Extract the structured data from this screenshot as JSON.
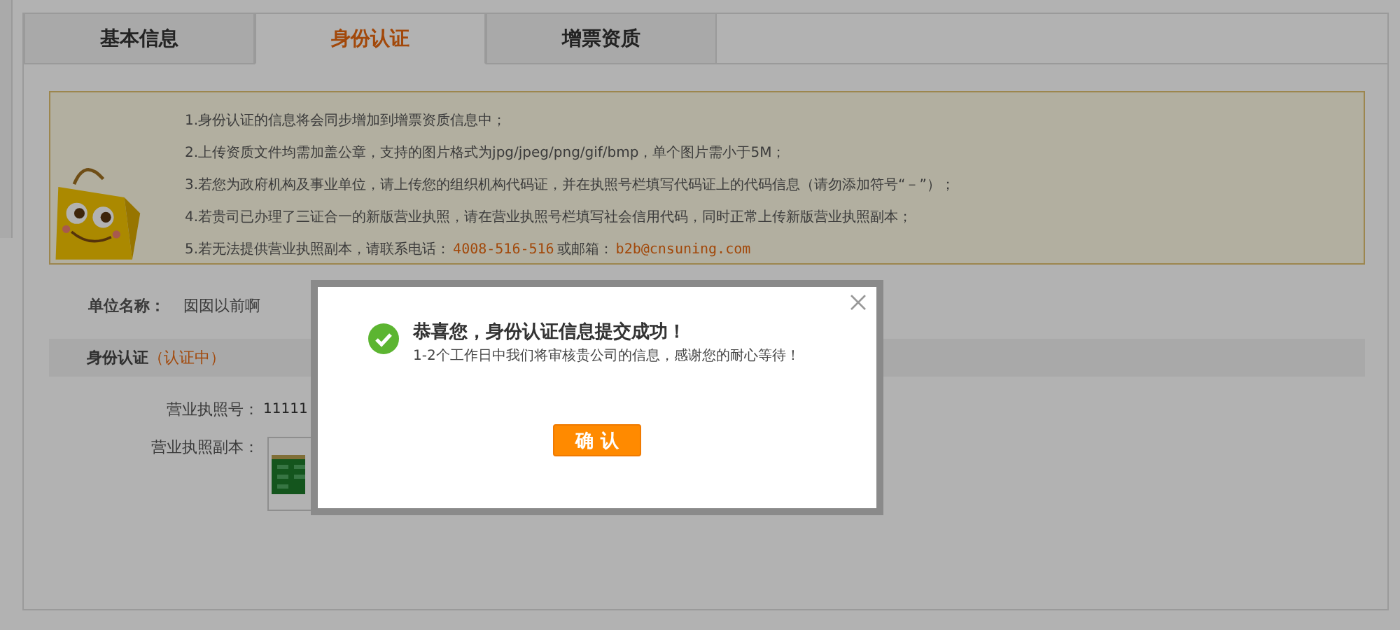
{
  "tabs": [
    {
      "label": "基本信息",
      "selected": false
    },
    {
      "label": "身份认证",
      "selected": true
    },
    {
      "label": "增票资质",
      "selected": false
    }
  ],
  "notice": {
    "lines": [
      "1.身份认证的信息将会同步增加到增票资质信息中；",
      "2.上传资质文件均需加盖公章，支持的图片格式为jpg/jpeg/png/gif/bmp，单个图片需小于5M；",
      "3.若您为政府机构及事业单位，请上传您的组织机构代码证，并在执照号栏填写代码证上的代码信息（请勿添加符号“－”）；",
      "4.若贵司已办理了三证合一的新版营业执照，请在营业执照号栏填写社会信用代码，同时正常上传新版营业执照副本；"
    ],
    "contact": {
      "text": "5.若无法提供营业执照副本，请联系电话：",
      "phone": "4008-516-516",
      "email_label": "或邮箱：",
      "email": "b2b@cnsuning.com"
    }
  },
  "company": {
    "label": "单位名称：",
    "value": "囡囡以前啊"
  },
  "section": {
    "title": "身份认证",
    "status": "（认证中）"
  },
  "license_number": {
    "label": "营业执照号：",
    "value": "11111"
  },
  "license_copy": {
    "label": "营业执照副本："
  },
  "dialog": {
    "title": "恭喜您，身份认证信息提交成功！",
    "message": "1-2个工作日中我们将审核贵公司的信息，感谢您的耐心等待！",
    "confirm": "确 认"
  }
}
